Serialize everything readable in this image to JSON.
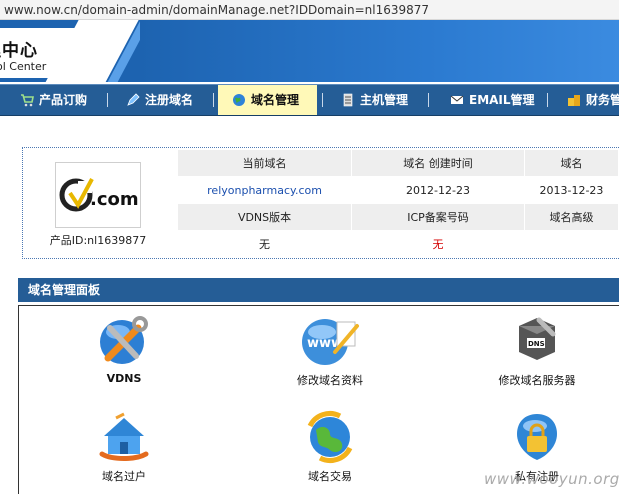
{
  "browser": {
    "url": "www.now.cn/domain-admin/domainManage.net?IDDomain=nl1639877"
  },
  "header": {
    "title_cn": "管理中心",
    "title_en": "Control Center"
  },
  "nav": {
    "items": [
      {
        "label": "产品订购",
        "icon": "cart-icon"
      },
      {
        "label": "注册域名",
        "icon": "pen-icon"
      },
      {
        "label": "域名管理",
        "icon": "globe-icon",
        "active": true
      },
      {
        "label": "主机管理",
        "icon": "server-icon"
      },
      {
        "label": "EMAIL管理",
        "icon": "mail-icon"
      },
      {
        "label": "财务管理",
        "icon": "money-icon"
      }
    ]
  },
  "product": {
    "logo_text": ".com",
    "id_label": "产品ID:nl1639877"
  },
  "info": {
    "headers1": [
      "当前域名",
      "域名 创建时间",
      "域名"
    ],
    "values1": [
      "relyonpharmacy.com",
      "2012-12-23",
      "2013-12-23"
    ],
    "headers2": [
      "VDNS版本",
      "ICP备案号码",
      "域名高级"
    ],
    "values2": [
      "无",
      "无",
      ""
    ]
  },
  "panel": {
    "title": "域名管理面板",
    "tiles": [
      {
        "label": "VDNS",
        "icon": "vdns-tools-icon"
      },
      {
        "label": "修改域名资料",
        "icon": "www-edit-icon"
      },
      {
        "label": "修改域名服务器",
        "icon": "dns-server-icon"
      },
      {
        "label": "域名过户",
        "icon": "house-transfer-icon"
      },
      {
        "label": "域名交易",
        "icon": "trade-globe-icon"
      },
      {
        "label": "私有注册",
        "icon": "lock-icon"
      }
    ]
  },
  "watermark": "www.wooyun.org"
}
